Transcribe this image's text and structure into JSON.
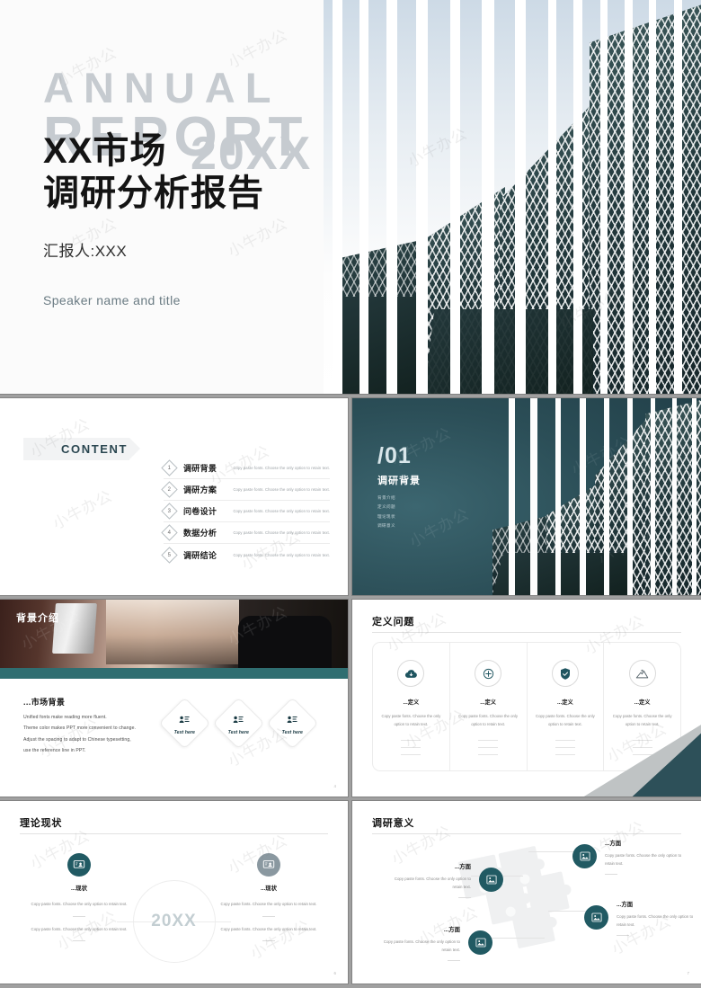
{
  "theme": {
    "teal": "#2d5059",
    "teal_dark": "#1f3b44",
    "ink": "#141414",
    "muted": "#8c8c8c",
    "pale": "#c6cbd0"
  },
  "watermark": {
    "text": "小牛办公"
  },
  "cover": {
    "annual": "ANNUAL",
    "report": "REPORT",
    "year": "20XX",
    "title_line1": "XX市场",
    "title_line2": "调研分析报告",
    "reporter": "汇报人:XXX",
    "speaker": "Speaker name and title"
  },
  "content": {
    "tag": "CONTENT",
    "items": [
      {
        "num": "1",
        "cn": "调研背景",
        "en": "Copy paste fonts. Choose the only option to retain text."
      },
      {
        "num": "2",
        "cn": "调研方案",
        "en": "Copy paste fonts. Choose the only option to retain text."
      },
      {
        "num": "3",
        "cn": "问卷设计",
        "en": "Copy paste fonts. Choose the only option to retain text."
      },
      {
        "num": "4",
        "cn": "数据分析",
        "en": "Copy paste fonts. Choose the only option to retain text."
      },
      {
        "num": "5",
        "cn": "调研结论",
        "en": "Copy paste fonts. Choose the only option to retain text."
      }
    ]
  },
  "section": {
    "number": "/01",
    "title": "调研背景",
    "subitems": [
      "背景介绍",
      "定义问题",
      "理论现状",
      "调研意义"
    ]
  },
  "background_intro": {
    "badge": "背景介绍",
    "heading": "...市场背景",
    "paragraph": [
      "Unified fonts make reading more fluent.",
      "Theme color makes PPT more convenient to change.",
      "Adjust the spacing to adapt to Chinese typesetting,",
      "use the reference line in PPT."
    ],
    "cards": [
      {
        "label": "Text here"
      },
      {
        "label": "Text here"
      },
      {
        "label": "Text here"
      }
    ],
    "page": "4"
  },
  "define_problem": {
    "title": "定义问题",
    "columns": [
      {
        "icon": "cloud-download-icon",
        "label": "...定义",
        "text": "Copy paste fonts. Choose the only option to retain text."
      },
      {
        "icon": "plus-circle-icon",
        "label": "...定义",
        "text": "Copy paste fonts. Choose the only option to retain text."
      },
      {
        "icon": "shield-check-icon",
        "label": "...定义",
        "text": "Copy paste fonts. Choose the only option to retain text."
      },
      {
        "icon": "mountain-icon",
        "label": "...定义",
        "text": "Copy paste fonts. Choose the only option to retain text."
      }
    ]
  },
  "theory_status": {
    "title": "理论现状",
    "center": "20XX",
    "left": {
      "label": "...现状",
      "text1": "Copy paste fonts. Choose the only option to retain text.",
      "text2": "Copy paste fonts. Choose the only option to retain text."
    },
    "right": {
      "label": "...现状",
      "text1": "Copy paste fonts. Choose the only option to retain text.",
      "text2": "Copy paste fonts. Choose the only option to retain text."
    },
    "page": "6"
  },
  "research_value": {
    "title": "调研意义",
    "nodes": [
      {
        "label": "...方面",
        "text": "Copy paste fonts. Choose the only option to retain text."
      },
      {
        "label": "...方面",
        "text": "Copy paste fonts. Choose the only option to retain text."
      },
      {
        "label": "...方面",
        "text": "Copy paste fonts. Choose the only option to retain text."
      },
      {
        "label": "...方面",
        "text": "Copy paste fonts. Choose the only option to retain text."
      }
    ],
    "page": "7"
  }
}
